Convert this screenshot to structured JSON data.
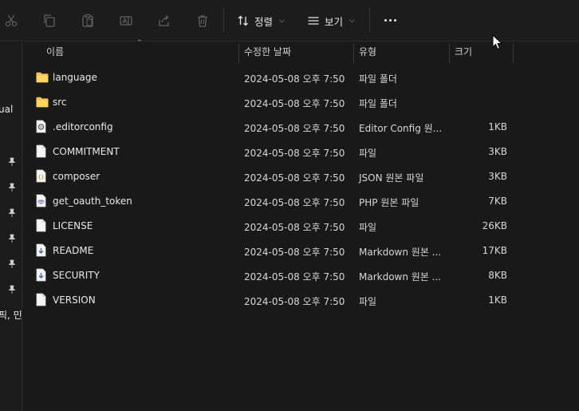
{
  "toolbar": {
    "icons": [
      "cut-icon",
      "copy-icon",
      "paste-icon",
      "rename-icon",
      "share-icon",
      "delete-icon"
    ],
    "sort_label": "정렬",
    "view_label": "보기"
  },
  "nav": {
    "fragment_1": "ual",
    "fragment_2": "픽, 민"
  },
  "columns": {
    "name": "이름",
    "date": "수정한 날짜",
    "type": "유형",
    "size": "크기"
  },
  "files": [
    {
      "name": "language",
      "date": "2024-05-08 오후 7:50",
      "type": "파일 폴더",
      "size": "",
      "icon": "folder"
    },
    {
      "name": "src",
      "date": "2024-05-08 오후 7:50",
      "type": "파일 폴더",
      "size": "",
      "icon": "folder"
    },
    {
      "name": ".editorconfig",
      "date": "2024-05-08 오후 7:50",
      "type": "Editor Config 원...",
      "size": "1KB",
      "icon": "config"
    },
    {
      "name": "COMMITMENT",
      "date": "2024-05-08 오후 7:50",
      "type": "파일",
      "size": "3KB",
      "icon": "file"
    },
    {
      "name": "composer",
      "date": "2024-05-08 오후 7:50",
      "type": "JSON 원본 파일",
      "size": "3KB",
      "icon": "json"
    },
    {
      "name": "get_oauth_token",
      "date": "2024-05-08 오후 7:50",
      "type": "PHP 원본 파일",
      "size": "7KB",
      "icon": "php"
    },
    {
      "name": "LICENSE",
      "date": "2024-05-08 오후 7:50",
      "type": "파일",
      "size": "26KB",
      "icon": "file"
    },
    {
      "name": "README",
      "date": "2024-05-08 오후 7:50",
      "type": "Markdown 원본 ...",
      "size": "17KB",
      "icon": "markdown"
    },
    {
      "name": "SECURITY",
      "date": "2024-05-08 오후 7:50",
      "type": "Markdown 원본 ...",
      "size": "8KB",
      "icon": "markdown"
    },
    {
      "name": "VERSION",
      "date": "2024-05-08 오후 7:50",
      "type": "파일",
      "size": "1KB",
      "icon": "file"
    }
  ],
  "colors": {
    "background": "#191919",
    "folder": "#f2c14e",
    "text": "#e8e8e8"
  }
}
